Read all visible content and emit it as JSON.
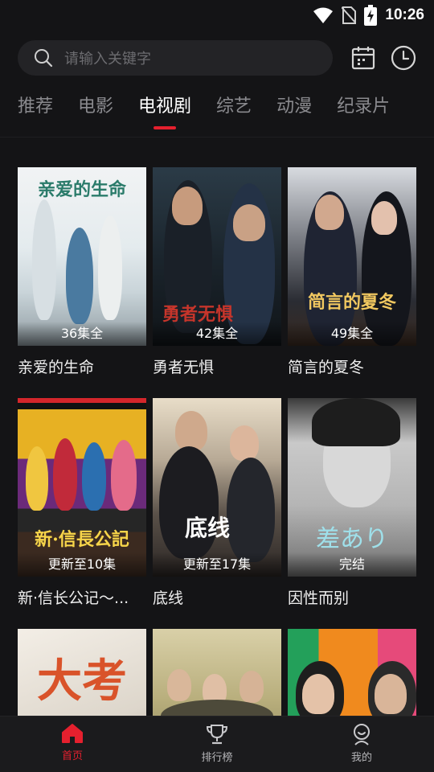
{
  "status": {
    "time": "10:26"
  },
  "search": {
    "placeholder": "请输入关键字"
  },
  "header_icons": [
    "calendar-icon",
    "history-clock-icon"
  ],
  "tabs": [
    {
      "label": "推荐"
    },
    {
      "label": "电影"
    },
    {
      "label": "电视剧",
      "active": true
    },
    {
      "label": "综艺"
    },
    {
      "label": "动漫"
    },
    {
      "label": "纪录片"
    }
  ],
  "items": [
    {
      "title": "亲爱的生命",
      "badge": "36集全",
      "poster_text": "亲爱的生命"
    },
    {
      "title": "勇者无惧",
      "badge": "42集全",
      "poster_text": "勇者无惧"
    },
    {
      "title": "简言的夏冬",
      "badge": "49集全",
      "poster_text": "简言的夏冬"
    },
    {
      "title": "新·信长公记～...",
      "badge": "更新至10集",
      "poster_text": "新·信長公記"
    },
    {
      "title": "底线",
      "badge": "更新至17集",
      "poster_text": "底线"
    },
    {
      "title": "因性而别",
      "badge": "完结",
      "poster_text": "差あり"
    },
    {
      "title": "",
      "badge": "",
      "poster_text": "大考"
    },
    {
      "title": "",
      "badge": "",
      "poster_text": ""
    },
    {
      "title": "",
      "badge": "",
      "poster_text": ""
    }
  ],
  "bottom_nav": [
    {
      "label": "首页",
      "icon": "home-icon",
      "active": true
    },
    {
      "label": "排行榜",
      "icon": "trophy-icon"
    },
    {
      "label": "我的",
      "icon": "profile-icon"
    }
  ],
  "colors": {
    "accent": "#e5202e",
    "background": "#141416",
    "search_bg": "#232326"
  }
}
